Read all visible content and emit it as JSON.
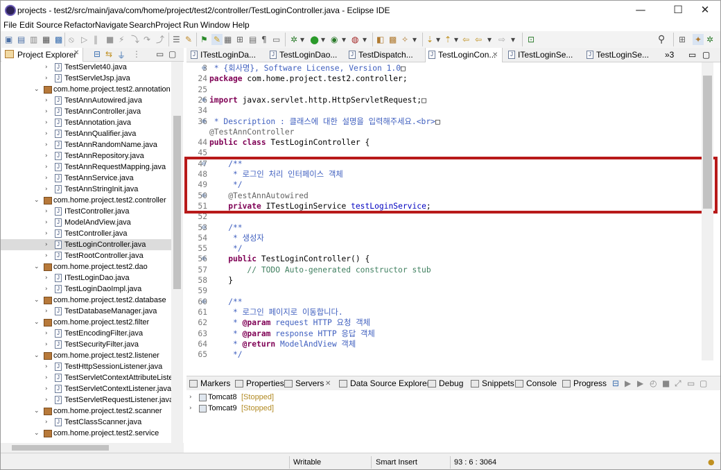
{
  "window": {
    "title": "projects - test2/src/main/java/com/home/project/test2/controller/TestLoginController.java - Eclipse IDE",
    "minimize": "—",
    "maximize": "☐",
    "close": "✕"
  },
  "menu": [
    "File",
    "Edit",
    "Source",
    "Refactor",
    "Navigate",
    "Search",
    "Project",
    "Run",
    "Window",
    "Help"
  ],
  "project_explorer": {
    "title": "Project Explorer",
    "rows": [
      {
        "label": "TestServlet40.java",
        "kind": "file",
        "indent": 1
      },
      {
        "label": "TestServletJsp.java",
        "kind": "file",
        "indent": 1
      },
      {
        "label": "com.home.project.test2.annotation",
        "kind": "package",
        "indent": 0
      },
      {
        "label": "TestAnnAutowired.java",
        "kind": "file",
        "indent": 1
      },
      {
        "label": "TestAnnController.java",
        "kind": "file",
        "indent": 1
      },
      {
        "label": "TestAnnotation.java",
        "kind": "file",
        "indent": 1
      },
      {
        "label": "TestAnnQualifier.java",
        "kind": "file",
        "indent": 1
      },
      {
        "label": "TestAnnRandomName.java",
        "kind": "file",
        "indent": 1
      },
      {
        "label": "TestAnnRepository.java",
        "kind": "file",
        "indent": 1
      },
      {
        "label": "TestAnnRequestMapping.java",
        "kind": "file",
        "indent": 1
      },
      {
        "label": "TestAnnService.java",
        "kind": "file",
        "indent": 1
      },
      {
        "label": "TestAnnStringInit.java",
        "kind": "file",
        "indent": 1
      },
      {
        "label": "com.home.project.test2.controller",
        "kind": "package",
        "indent": 0
      },
      {
        "label": "ITestController.java",
        "kind": "file",
        "indent": 1
      },
      {
        "label": "ModelAndView.java",
        "kind": "file",
        "indent": 1
      },
      {
        "label": "TestController.java",
        "kind": "file",
        "indent": 1
      },
      {
        "label": "TestLoginController.java",
        "kind": "file",
        "indent": 1,
        "selected": true
      },
      {
        "label": "TestRootController.java",
        "kind": "file",
        "indent": 1
      },
      {
        "label": "com.home.project.test2.dao",
        "kind": "package",
        "indent": 0
      },
      {
        "label": "ITestLoginDao.java",
        "kind": "file",
        "indent": 1
      },
      {
        "label": "TestLoginDaoImpl.java",
        "kind": "file",
        "indent": 1
      },
      {
        "label": "com.home.project.test2.database",
        "kind": "package",
        "indent": 0
      },
      {
        "label": "TestDatabaseManager.java",
        "kind": "file",
        "indent": 1
      },
      {
        "label": "com.home.project.test2.filter",
        "kind": "package",
        "indent": 0
      },
      {
        "label": "TestEncodingFilter.java",
        "kind": "file",
        "indent": 1
      },
      {
        "label": "TestSecurityFilter.java",
        "kind": "file",
        "indent": 1
      },
      {
        "label": "com.home.project.test2.listener",
        "kind": "package",
        "indent": 0
      },
      {
        "label": "TestHttpSessionListener.java",
        "kind": "file",
        "indent": 1
      },
      {
        "label": "TestServletContextAttributeListe",
        "kind": "file",
        "indent": 1
      },
      {
        "label": "TestServletContextListener.java",
        "kind": "file",
        "indent": 1
      },
      {
        "label": "TestServletRequestListener.java",
        "kind": "file",
        "indent": 1
      },
      {
        "label": "com.home.project.test2.scanner",
        "kind": "package",
        "indent": 0
      },
      {
        "label": "TestClassScanner.java",
        "kind": "file",
        "indent": 1
      },
      {
        "label": "com.home.project.test2.service",
        "kind": "package",
        "indent": 0
      }
    ]
  },
  "editor_tabs": [
    {
      "label": "ITestLoginDa...",
      "active": false
    },
    {
      "label": "TestLoginDao...",
      "active": false
    },
    {
      "label": "TestDispatch...",
      "active": false
    },
    {
      "label": "TestLoginCon...",
      "active": true
    },
    {
      "label": "ITestLoginSe...",
      "active": false
    },
    {
      "label": "TestLoginSe...",
      "active": false
    }
  ],
  "editor_overflow": "»3",
  "code_lines": [
    {
      "n": "3",
      "fold": "⊕",
      "segs": [
        [
          "cm",
          " * {회사명}, Software License, Version 1.0"
        ],
        [
          "",
          "□"
        ]
      ]
    },
    {
      "n": "24",
      "segs": [
        [
          "kw",
          "package"
        ],
        [
          "",
          " com.home.project.test2.controller;"
        ]
      ]
    },
    {
      "n": "25",
      "segs": []
    },
    {
      "n": "26",
      "fold": "⊕",
      "segs": [
        [
          "kw",
          "import"
        ],
        [
          "",
          " javax.servlet.http.HttpServletRequest;"
        ],
        [
          "",
          "□"
        ]
      ]
    },
    {
      "n": "34",
      "segs": []
    },
    {
      "n": "36",
      "fold": "⊕",
      "segs": [
        [
          "cm",
          " * Description : 클래스에 대한 설명을 입력해주세요.<br>"
        ],
        [
          "",
          "□"
        ]
      ]
    },
    {
      "n": "",
      "segs": [
        [
          "an",
          "@TestAnnController"
        ]
      ]
    },
    {
      "n": "44",
      "segs": [
        [
          "kw",
          "public class"
        ],
        [
          "",
          " TestLoginController {"
        ]
      ]
    },
    {
      "n": "45",
      "segs": []
    },
    {
      "n": "47",
      "fold": "⊖",
      "segs": [
        [
          "cm",
          "    /**"
        ]
      ]
    },
    {
      "n": "48",
      "segs": [
        [
          "cm",
          "     * 로그인 처리 인터페이스 객체"
        ]
      ]
    },
    {
      "n": "49",
      "segs": [
        [
          "cm",
          "     */"
        ]
      ]
    },
    {
      "n": "50",
      "fold": "⊖",
      "segs": [
        [
          "an",
          "    @TestAnnAutowired"
        ]
      ]
    },
    {
      "n": "51",
      "segs": [
        [
          "",
          "    "
        ],
        [
          "kw",
          "private"
        ],
        [
          "",
          " ITestLoginService "
        ],
        [
          "fd",
          "testLoginService"
        ],
        [
          "",
          ";"
        ]
      ]
    },
    {
      "n": "52",
      "segs": []
    },
    {
      "n": "53",
      "fold": "⊖",
      "segs": [
        [
          "cm",
          "    /**"
        ]
      ]
    },
    {
      "n": "54",
      "segs": [
        [
          "cm",
          "     * 생성자"
        ]
      ]
    },
    {
      "n": "55",
      "segs": [
        [
          "cm",
          "     */"
        ]
      ]
    },
    {
      "n": "56",
      "fold": "⊖",
      "segs": [
        [
          "",
          "    "
        ],
        [
          "kw",
          "public"
        ],
        [
          "",
          " TestLoginController() {"
        ]
      ]
    },
    {
      "n": "57",
      "segs": [
        [
          "cmg",
          "        // TODO Auto-generated constructor stub"
        ]
      ]
    },
    {
      "n": "58",
      "segs": [
        [
          "",
          "    }"
        ]
      ]
    },
    {
      "n": "59",
      "segs": []
    },
    {
      "n": "60",
      "fold": "⊖",
      "segs": [
        [
          "cm",
          "    /**"
        ]
      ]
    },
    {
      "n": "61",
      "segs": [
        [
          "cm",
          "     * 로그인 페이지로 이동합니다."
        ]
      ]
    },
    {
      "n": "62",
      "segs": [
        [
          "cm",
          "     * "
        ],
        [
          "kw",
          "@param"
        ],
        [
          "cm",
          " request HTTP 요청 객체"
        ]
      ]
    },
    {
      "n": "63",
      "segs": [
        [
          "cm",
          "     * "
        ],
        [
          "kw",
          "@param"
        ],
        [
          "cm",
          " response HTTP 응답 객체"
        ]
      ]
    },
    {
      "n": "64",
      "segs": [
        [
          "cm",
          "     * "
        ],
        [
          "kw",
          "@return"
        ],
        [
          "cm",
          " ModelAndView 객체"
        ]
      ]
    },
    {
      "n": "65",
      "segs": [
        [
          "cm",
          "     */"
        ]
      ]
    }
  ],
  "bottom_tabs": [
    "Markers",
    "Properties",
    "Servers",
    "Data Source Explorer",
    "Debug",
    "Snippets",
    "Console",
    "Progress"
  ],
  "servers": [
    {
      "name": "Tomcat8",
      "status": "[Stopped]"
    },
    {
      "name": "Tomcat9",
      "status": "[Stopped]"
    }
  ],
  "status_bar": {
    "mode": "Writable",
    "insert": "Smart Insert",
    "position": "93 : 6 : 3064"
  },
  "colors": {
    "accent": "#b81a1a",
    "keyword": "#7f0055",
    "javadoc": "#3f5fbf",
    "comment": "#3f7f5f",
    "annotation": "#646464",
    "field": "#0000c0",
    "stopped": "#b28a23"
  }
}
